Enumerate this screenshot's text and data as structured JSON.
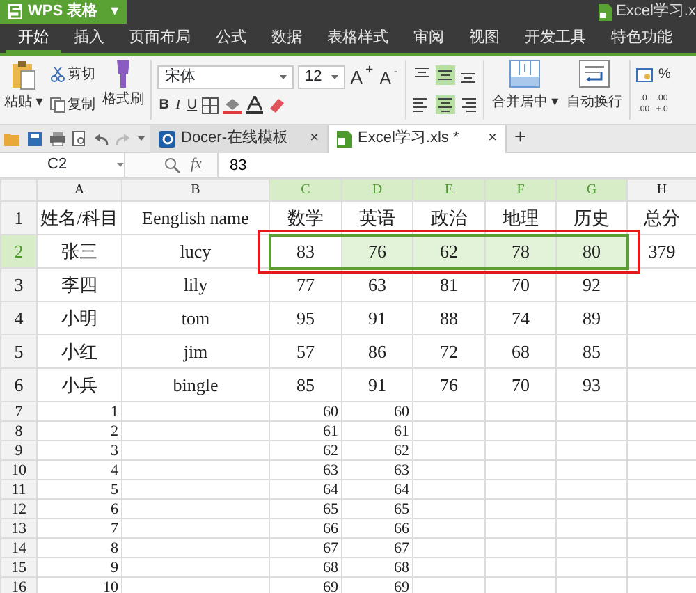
{
  "title_bar": {
    "app_name": "WPS 表格",
    "caret": "▾",
    "file_name": "Excel学习.x"
  },
  "menu_tabs": [
    {
      "label": "开始",
      "selected": true
    },
    {
      "label": "插入",
      "selected": false
    },
    {
      "label": "页面布局",
      "selected": false
    },
    {
      "label": "公式",
      "selected": false
    },
    {
      "label": "数据",
      "selected": false
    },
    {
      "label": "表格样式",
      "selected": false
    },
    {
      "label": "审阅",
      "selected": false
    },
    {
      "label": "视图",
      "selected": false
    },
    {
      "label": "开发工具",
      "selected": false
    },
    {
      "label": "特色功能",
      "selected": false
    }
  ],
  "ribbon": {
    "paste": "粘贴",
    "caret": "▾",
    "cut": "剪切",
    "copy": "复制",
    "format_painter": "格式刷",
    "font": "宋体",
    "font_size": "12",
    "grow": "A$^{+}$",
    "shrink": "A$^{-}$",
    "bold": "B",
    "italic": "I",
    "underline": "U",
    "align_buttons": [
      {
        "kind": "top",
        "selected": false
      },
      {
        "kind": "middle",
        "selected": true
      },
      {
        "kind": "bottom",
        "selected": false
      },
      {
        "kind": "left",
        "selected": false
      },
      {
        "kind": "center",
        "selected": true
      },
      {
        "kind": "right",
        "selected": false
      }
    ],
    "merge": "合并居中",
    "wrap": "自动换行",
    "percent": "%",
    "decimals": [
      ".0\n.00",
      ".00\n+.0"
    ]
  },
  "doc_tabs": [
    {
      "label": "Docer-在线模板",
      "selected": false,
      "kind": "docer"
    },
    {
      "label": "Excel学习.xls *",
      "selected": true,
      "kind": "sheet"
    }
  ],
  "new_tab": "+",
  "close_mark": "×",
  "formula_bar": {
    "name_box": "C2",
    "fx": "fx",
    "value": "83"
  },
  "columns": [
    {
      "label": "A",
      "selected": false
    },
    {
      "label": "B",
      "selected": false
    },
    {
      "label": "C",
      "selected": true
    },
    {
      "label": "D",
      "selected": true
    },
    {
      "label": "E",
      "selected": true
    },
    {
      "label": "F",
      "selected": true
    },
    {
      "label": "G",
      "selected": true
    },
    {
      "label": "H",
      "selected": false
    }
  ],
  "rows": [
    {
      "label": "1",
      "selected": false,
      "cells": [
        "姓名/科目",
        "Eenglish name",
        "数学",
        "英语",
        "政治",
        "地理",
        "历史",
        "总分"
      ]
    },
    {
      "label": "2",
      "selected": true,
      "cells": [
        "张三",
        "lucy",
        "83",
        "76",
        "62",
        "78",
        "80",
        "379"
      ]
    },
    {
      "label": "3",
      "selected": false,
      "cells": [
        "李四",
        "lily",
        "77",
        "63",
        "81",
        "70",
        "92",
        ""
      ]
    },
    {
      "label": "4",
      "selected": false,
      "cells": [
        "小明",
        "tom",
        "95",
        "91",
        "88",
        "74",
        "89",
        ""
      ]
    },
    {
      "label": "5",
      "selected": false,
      "cells": [
        "小红",
        "jim",
        "57",
        "86",
        "72",
        "68",
        "85",
        ""
      ]
    },
    {
      "label": "6",
      "selected": false,
      "cells": [
        "小兵",
        "bingle",
        "85",
        "91",
        "76",
        "70",
        "93",
        ""
      ]
    },
    {
      "label": "7",
      "selected": false,
      "cells": [
        "1",
        "",
        "60",
        "60",
        "",
        "",
        "",
        ""
      ]
    },
    {
      "label": "8",
      "selected": false,
      "cells": [
        "2",
        "",
        "61",
        "61",
        "",
        "",
        "",
        ""
      ]
    },
    {
      "label": "9",
      "selected": false,
      "cells": [
        "3",
        "",
        "62",
        "62",
        "",
        "",
        "",
        ""
      ]
    },
    {
      "label": "10",
      "selected": false,
      "cells": [
        "4",
        "",
        "63",
        "63",
        "",
        "",
        "",
        ""
      ]
    },
    {
      "label": "11",
      "selected": false,
      "cells": [
        "5",
        "",
        "64",
        "64",
        "",
        "",
        "",
        ""
      ]
    },
    {
      "label": "12",
      "selected": false,
      "cells": [
        "6",
        "",
        "65",
        "65",
        "",
        "",
        "",
        ""
      ]
    },
    {
      "label": "13",
      "selected": false,
      "cells": [
        "7",
        "",
        "66",
        "66",
        "",
        "",
        "",
        ""
      ]
    },
    {
      "label": "14",
      "selected": false,
      "cells": [
        "8",
        "",
        "67",
        "67",
        "",
        "",
        "",
        ""
      ]
    },
    {
      "label": "15",
      "selected": false,
      "cells": [
        "9",
        "",
        "68",
        "68",
        "",
        "",
        "",
        ""
      ]
    },
    {
      "label": "16",
      "selected": false,
      "cells": [
        "10",
        "",
        "69",
        "69",
        "",
        "",
        "",
        ""
      ]
    }
  ],
  "annotation_box": true
}
